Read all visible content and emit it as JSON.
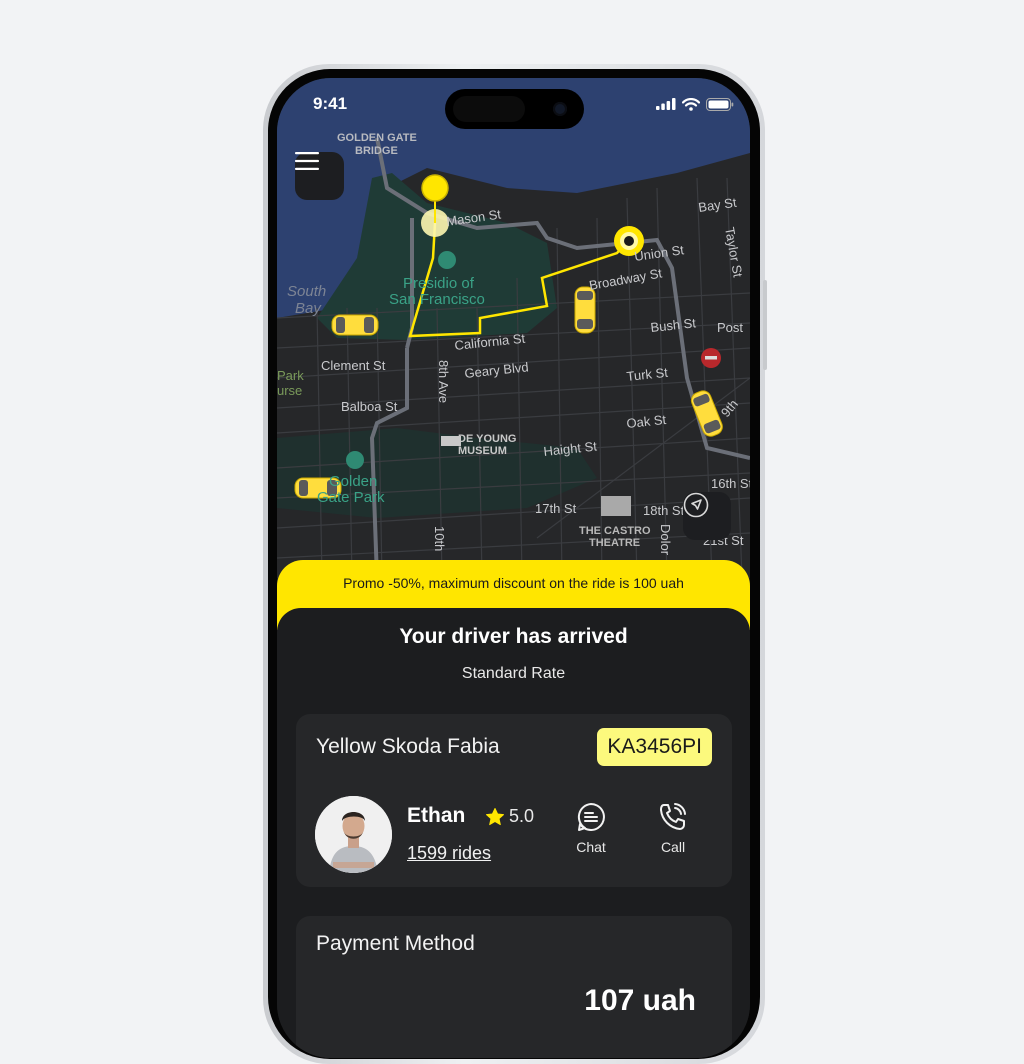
{
  "status_bar": {
    "time": "9:41"
  },
  "map": {
    "labels": {
      "golden_gate_1": "GOLDEN GATE",
      "golden_gate_2": "BRIDGE",
      "mason": "Mason St",
      "presidio_1": "Presidio of",
      "presidio_2": "San Francisco",
      "south_bay_1": "South",
      "south_bay_2": "Bay",
      "union": "Union St",
      "broadway": "Broadway St",
      "bay": "Bay St",
      "taylor": "Taylor St",
      "california": "California St",
      "bush": "Bush St",
      "post": "Post",
      "clement": "Clement St",
      "geary": "Geary Blvd",
      "eighth": "8th Ave",
      "turk": "Turk St",
      "park_1": "Park",
      "park_2": "urse",
      "balboa": "Balboa St",
      "oak": "Oak St",
      "ninth": "9th",
      "deyoung_1": "DE YOUNG",
      "deyoung_2": "MUSEUM",
      "haight": "Haight St",
      "ggpark_1": "Golden",
      "ggpark_2": "Gate Park",
      "sixteenth": "16th St",
      "seventeenth": "17th St",
      "eighteenth": "18th St",
      "castro_1": "THE CASTRO",
      "castro_2": "THEATRE",
      "tenth": "10th",
      "dolores": "Dolor",
      "twentyfirst": "21st St"
    },
    "route_color": "#ffe600"
  },
  "promo": {
    "text": "Promo -50%, maximum discount on the ride is 100 uah"
  },
  "sheet": {
    "title": "Your driver has arrived",
    "subtitle": "Standard Rate"
  },
  "driver_card": {
    "car": "Yellow Skoda Fabia",
    "plate": "KA3456PI",
    "driver_name": "Ethan",
    "rating": "5.0",
    "rides": "1599 rides",
    "chat_label": "Chat",
    "call_label": "Call"
  },
  "payment": {
    "title": "Payment Method",
    "amount": "107 uah"
  },
  "colors": {
    "accent": "#ffe600",
    "plate_bg": "#fcf97d",
    "sheet_bg": "#1c1d1f",
    "card_bg": "#262729"
  }
}
